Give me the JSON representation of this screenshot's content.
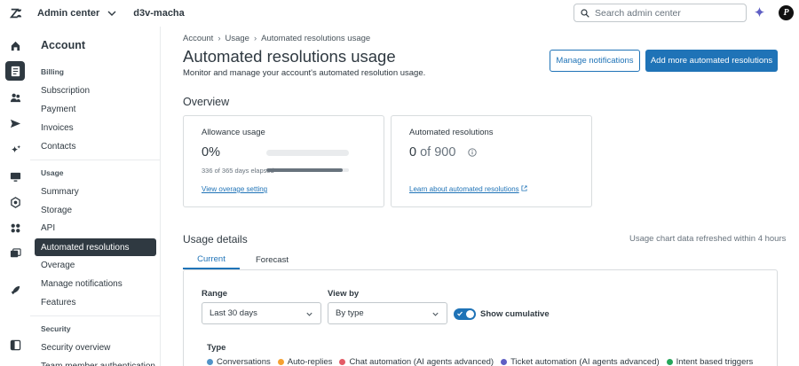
{
  "topbar": {
    "product": "Admin center",
    "account": "d3v-macha",
    "search_placeholder": "Search admin center",
    "avatar_letter": "P"
  },
  "sidebar": {
    "title": "Account",
    "sections": [
      {
        "label": "Billing",
        "items": [
          "Subscription",
          "Payment",
          "Invoices",
          "Contacts"
        ]
      },
      {
        "label": "Usage",
        "items": [
          "Summary",
          "Storage",
          "API",
          "Automated resolutions",
          "Overage",
          "Manage notifications",
          "Features"
        ]
      },
      {
        "label": "Security",
        "items": [
          "Security overview",
          "Team member authentication"
        ]
      }
    ],
    "active_item": "Automated resolutions"
  },
  "breadcrumb": [
    "Account",
    "Usage",
    "Automated resolutions usage"
  ],
  "header": {
    "title": "Automated resolutions usage",
    "subtitle": "Monitor and manage your account's automated resolution usage.",
    "manage_notifications_label": "Manage notifications",
    "add_more_label": "Add more automated resolutions"
  },
  "overview": {
    "heading": "Overview",
    "allowance": {
      "label": "Allowance usage",
      "value": "0%",
      "usage_fraction": 0.0,
      "elapsed_text": "336 of 365 days elapsed",
      "elapsed_fraction": 0.92,
      "link": "View overage setting"
    },
    "resolutions": {
      "label": "Automated resolutions",
      "used": "0",
      "of_total": "of 900",
      "link": "Learn about automated resolutions"
    }
  },
  "usage_details": {
    "heading": "Usage details",
    "refresh_note": "Usage chart data refreshed within 4 hours",
    "tabs": [
      "Current",
      "Forecast"
    ],
    "active_tab": "Current",
    "range_label": "Range",
    "range_value": "Last 30 days",
    "view_by_label": "View by",
    "view_by_value": "By type",
    "cumulative_label": "Show cumulative",
    "cumulative_on": true,
    "type_label": "Type",
    "types": [
      {
        "name": "Conversations",
        "color": "#5293c7"
      },
      {
        "name": "Auto-replies",
        "color": "#f5a133"
      },
      {
        "name": "Chat automation (AI agents advanced)",
        "color": "#e35b66"
      },
      {
        "name": "Ticket automation (AI agents advanced)",
        "color": "#5f5fc4"
      },
      {
        "name": "Intent based triggers",
        "color": "#26a65b"
      }
    ]
  },
  "colors": {
    "accent": "#1f73b7",
    "dark": "#2f3941"
  }
}
